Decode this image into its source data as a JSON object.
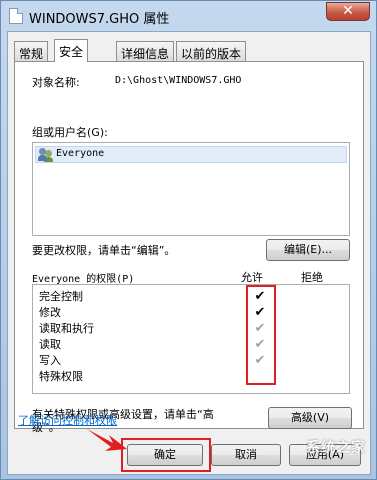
{
  "window": {
    "title": "WINDOWS7.GHO 属性",
    "close_glyph": "✕"
  },
  "tabs": [
    {
      "label": "常规",
      "active": false
    },
    {
      "label": "安全",
      "active": true
    },
    {
      "label": "详细信息",
      "active": false
    },
    {
      "label": "以前的版本",
      "active": false
    }
  ],
  "security": {
    "object_name_label": "对象名称:",
    "object_name_value": "D:\\Ghost\\WINDOWS7.GHO",
    "groups_label": "组或用户名(G):",
    "users": [
      {
        "name": "Everyone",
        "icon": "users-icon"
      }
    ],
    "change_perm_text": "要更改权限，请单击“编辑”。",
    "edit_button": "编辑(E)...",
    "permissions_label": "Everyone 的权限(P)",
    "allow_header": "允许",
    "deny_header": "拒绝",
    "permissions": [
      {
        "name": "完全控制",
        "allow": true,
        "inherited": false
      },
      {
        "name": "修改",
        "allow": true,
        "inherited": false
      },
      {
        "name": "读取和执行",
        "allow": true,
        "inherited": true
      },
      {
        "name": "读取",
        "allow": true,
        "inherited": true
      },
      {
        "name": "写入",
        "allow": true,
        "inherited": true
      },
      {
        "name": "特殊权限",
        "allow": false,
        "inherited": false
      }
    ],
    "advanced_text_line1": "有关特殊权限或高级设置，请单击“高",
    "advanced_text_line2": "级”。",
    "advanced_button": "高级(V)",
    "learn_link": "了解访问控制和权限"
  },
  "footer": {
    "ok_button": "确定",
    "cancel_button": "取消",
    "apply_button": "应用(A)"
  },
  "watermark_text": "系统之家",
  "colors": {
    "highlight_box": "#e02020",
    "link": "#0066cc",
    "arrow": "#e02020"
  }
}
